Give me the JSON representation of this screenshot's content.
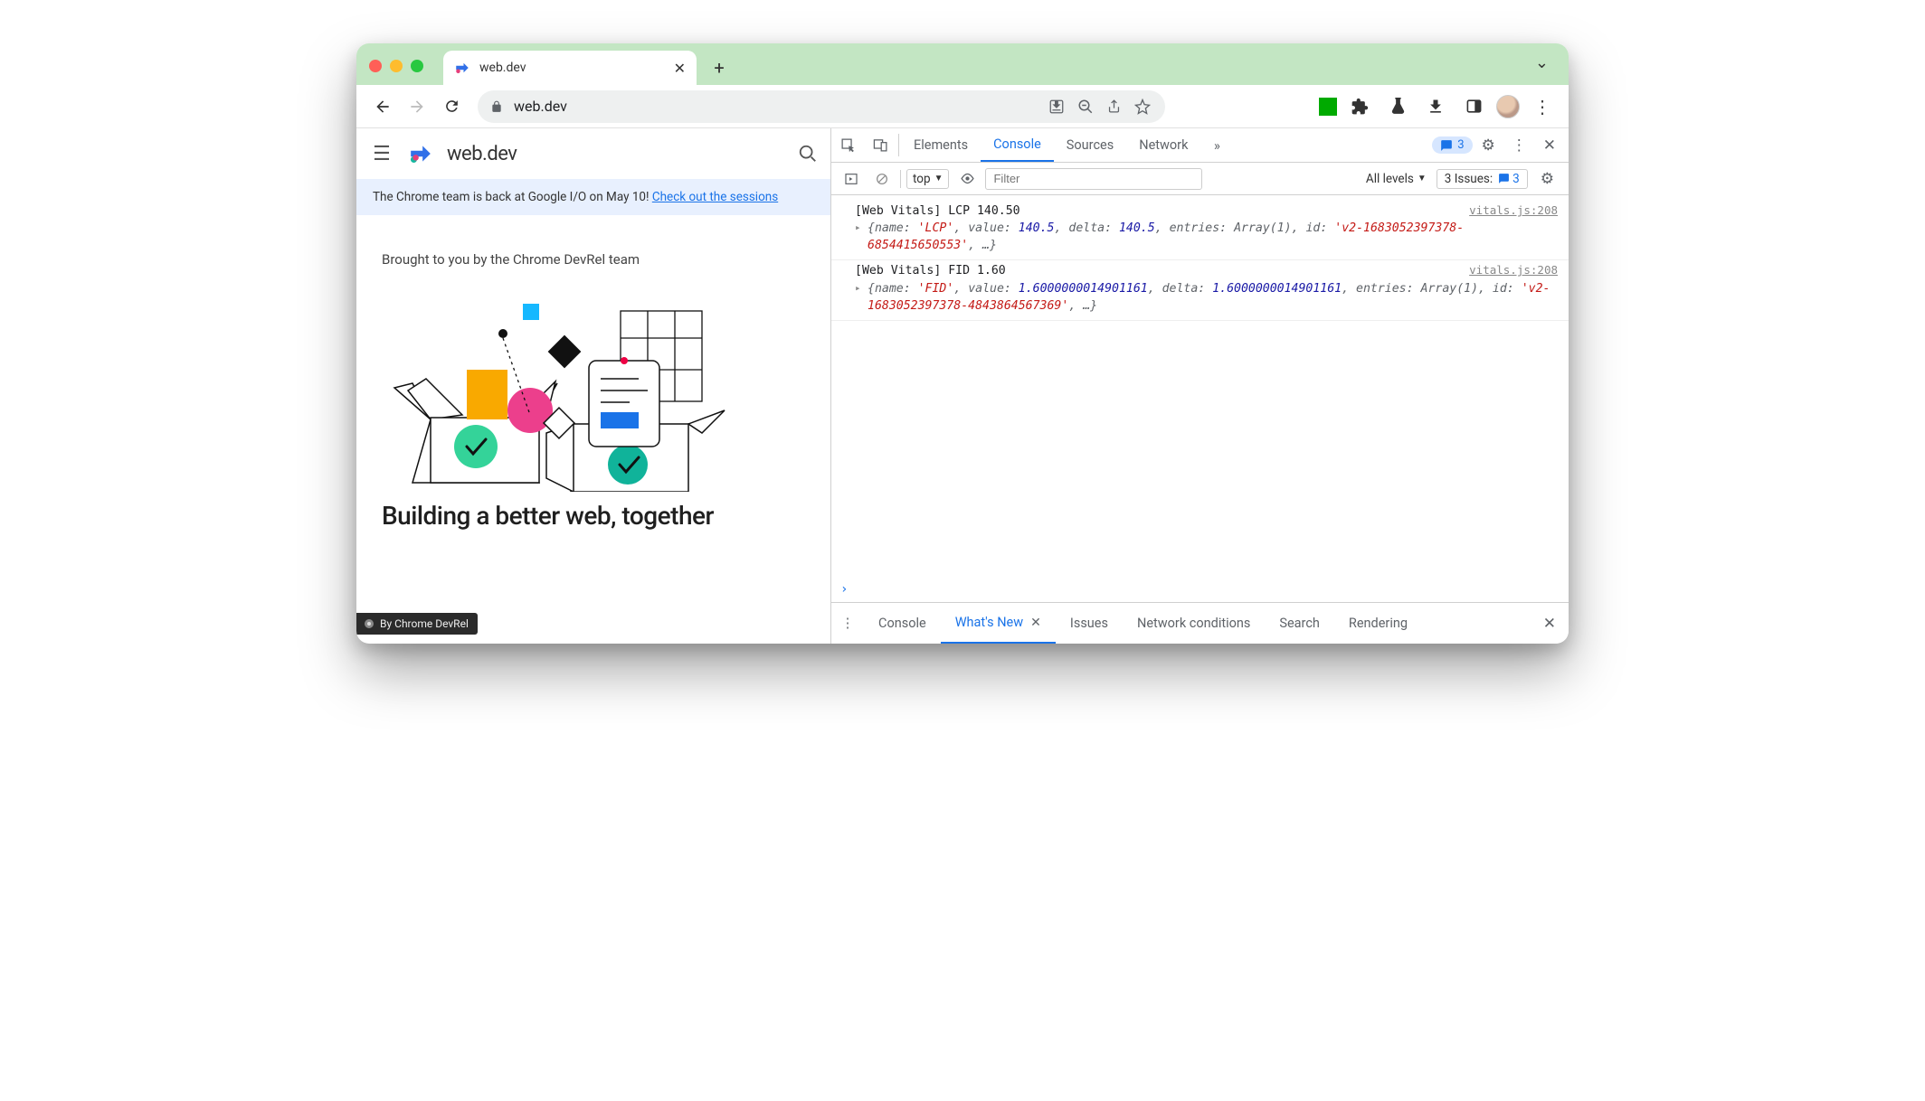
{
  "chrome": {
    "tab_title": "web.dev",
    "url_display": "web.dev"
  },
  "page": {
    "site_name": "web.dev",
    "banner_text": "The Chrome team is back at Google I/O on May 10! ",
    "banner_link": "Check out the sessions",
    "subtitle": "Brought to you by the Chrome DevRel team",
    "headline": "Building a better web, together",
    "devrel_badge": "By    Chrome DevRel"
  },
  "devtools": {
    "tabs": [
      "Elements",
      "Console",
      "Sources",
      "Network"
    ],
    "active_tab": "Console",
    "messages_badge": "3",
    "filter": {
      "context": "top",
      "placeholder": "Filter",
      "levels": "All levels",
      "issues_label": "3 Issues:",
      "issues_count": "3"
    },
    "logs": [
      {
        "src": "vitals.js:208",
        "line1": "[Web Vitals] LCP 140.50",
        "obj_html": "{<span class='k'>name:</span> <span class='s'>'LCP'</span>, <span class='k'>value:</span> <span class='n'>140.5</span>, <span class='k'>delta:</span> <span class='n'>140.5</span>, <span class='k'>entries:</span> <span class='g'>Array(1)</span>, <span class='k'>id:</span> <span class='s'>'v2-1683052397378-6854415650553'</span>, …}"
      },
      {
        "src": "vitals.js:208",
        "line1": "[Web Vitals] FID 1.60",
        "obj_html": "{<span class='k'>name:</span> <span class='s'>'FID'</span>, <span class='k'>value:</span> <span class='n'>1.6000000014901161</span>, <span class='k'>delta:</span> <span class='n'>1.6000000014901161</span>, <span class='k'>entries:</span> <span class='g'>Array(1)</span>, <span class='k'>id:</span> <span class='s'>'v2-1683052397378-4843864567369'</span>, …}"
      }
    ],
    "drawer": {
      "tabs": [
        "Console",
        "What's New",
        "Issues",
        "Network conditions",
        "Search",
        "Rendering"
      ],
      "active": "What's New"
    }
  }
}
